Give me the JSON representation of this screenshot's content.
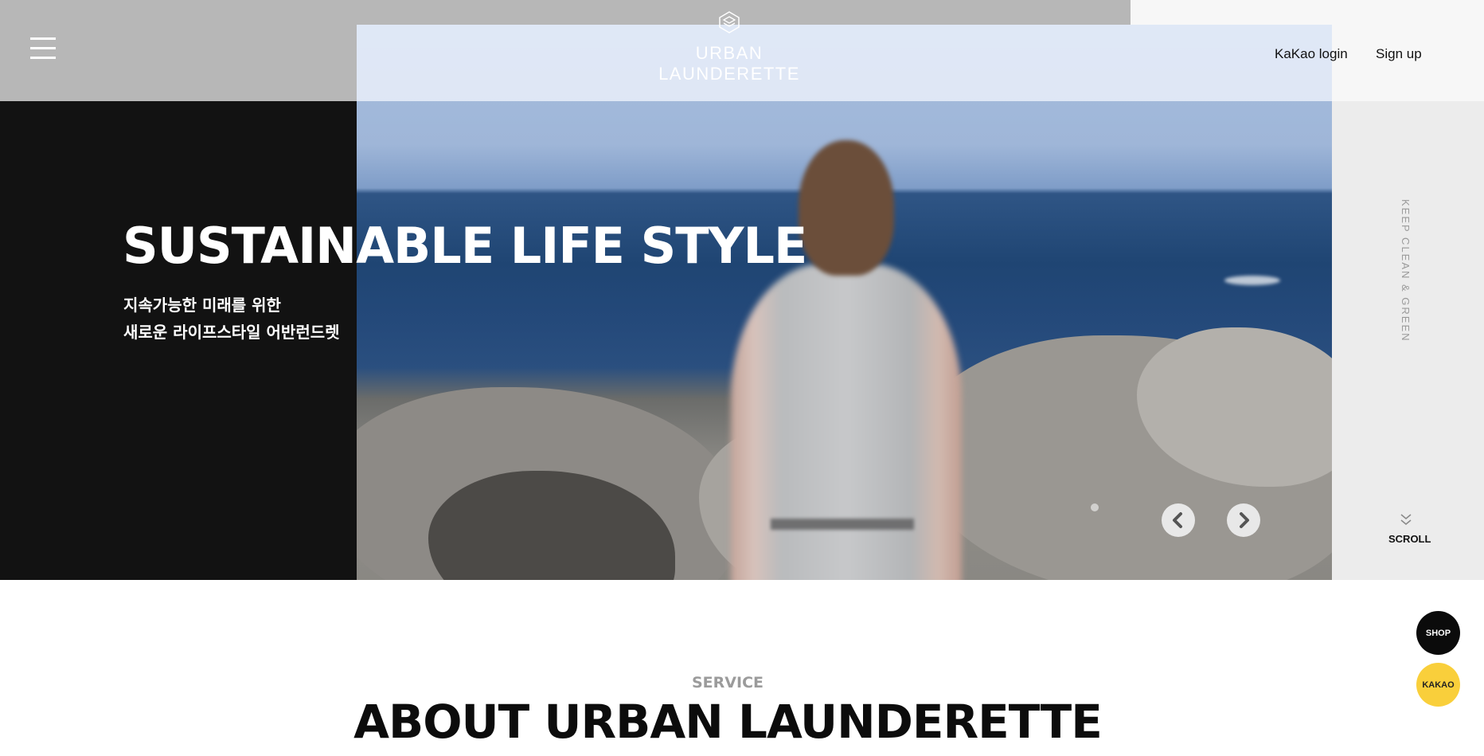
{
  "header": {
    "menu_icon": "hamburger-icon",
    "logo_icon": "hexagon-logo-icon",
    "logo_text": "URBAN LAUNDERETTE",
    "kakao_login": "KaKao login",
    "sign_up": "Sign up"
  },
  "hero": {
    "title": "SUSTAINABLE LIFE STYLE",
    "subtitle_line1": "지속가능한 미래를 위한",
    "subtitle_line2": "새로운 라이프스타일 어반런드렛",
    "prev_icon": "chevron-left-icon",
    "next_icon": "chevron-right-icon"
  },
  "side": {
    "vertical_text": "KEEP CLEAN & GREEN",
    "scroll_icon": "double-chevron-down-icon",
    "scroll_label": "SCROLL"
  },
  "floating": {
    "shop": "SHOP",
    "kakao": "KAKAO"
  },
  "about": {
    "eyebrow": "SERVICE",
    "title": "ABOUT URBAN LAUNDERETTE"
  },
  "colors": {
    "header_gray": "#b7b7b7",
    "black_panel": "#121212",
    "side_panel": "#ececec",
    "kakao_yellow": "#f9cf3b",
    "shop_black": "#0b0b0b",
    "eyebrow_gray": "#9b9b9b"
  }
}
